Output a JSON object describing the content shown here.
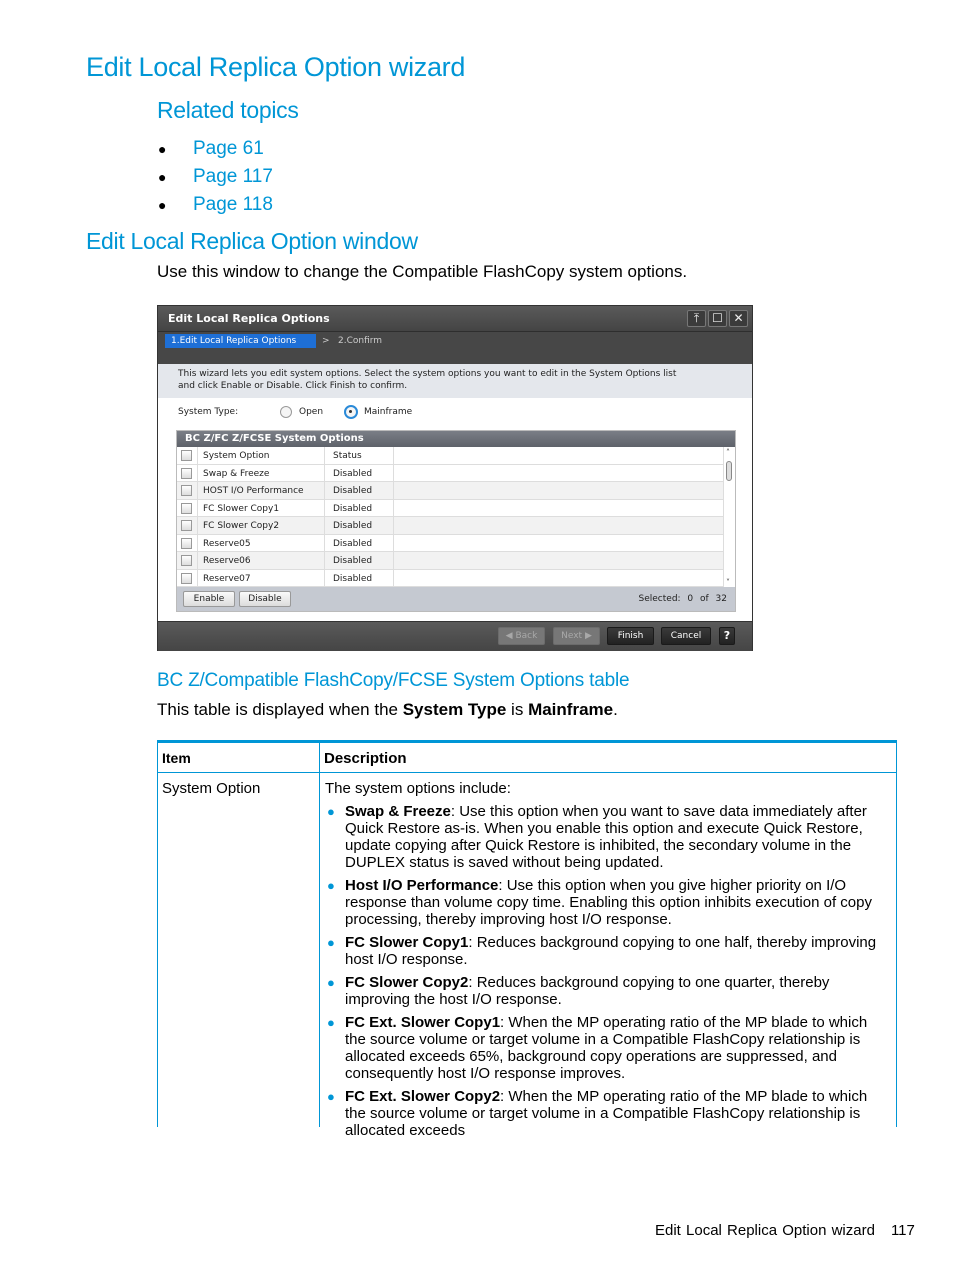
{
  "heading": "Edit Local Replica Option wizard",
  "related": {
    "title": "Related topics",
    "links": [
      "Page 61",
      "Page 117",
      "Page 118"
    ]
  },
  "window_section": {
    "title": "Edit Local Replica Option window",
    "intro": "Use this window to change the Compatible FlashCopy system options."
  },
  "dialog": {
    "title": "Edit Local Replica Options",
    "window_buttons": [
      "pin",
      "maximize",
      "close"
    ],
    "steps": {
      "current": "1.Edit Local Replica Options",
      "separator": ">",
      "next": "2.Confirm"
    },
    "description_line1": "This wizard lets you edit system options. Select the system options you want to edit in the System Options list",
    "description_line2": "and click Enable or Disable. Click Finish to confirm.",
    "system_type": {
      "label": "System Type:",
      "options": [
        "Open",
        "Mainframe"
      ],
      "selected": "Mainframe"
    },
    "panel_title": "BC Z/FC Z/FCSE System Options",
    "columns": [
      "System Option",
      "Status"
    ],
    "rows": [
      {
        "option": "Swap & Freeze",
        "status": "Disabled"
      },
      {
        "option": "HOST I/O Performance",
        "status": "Disabled"
      },
      {
        "option": "FC Slower Copy1",
        "status": "Disabled"
      },
      {
        "option": "FC Slower Copy2",
        "status": "Disabled"
      },
      {
        "option": "Reserve05",
        "status": "Disabled"
      },
      {
        "option": "Reserve06",
        "status": "Disabled"
      },
      {
        "option": "Reserve07",
        "status": "Disabled"
      }
    ],
    "enable_label": "Enable",
    "disable_label": "Disable",
    "selected_text": "Selected: 0 of 32",
    "footer": {
      "back": "Back",
      "next": "Next",
      "finish": "Finish",
      "cancel": "Cancel",
      "help": "?"
    }
  },
  "table_section": {
    "title": "BC Z/Compatible FlashCopy/FCSE System Options table",
    "intro_pre": "This table is displayed when the ",
    "intro_b1": "System Type",
    "intro_mid": " is ",
    "intro_b2": "Mainframe",
    "intro_post": ".",
    "headers": [
      "Item",
      "Description"
    ],
    "row_item": "System Option",
    "row_intro": "The system options include:",
    "bullets": [
      {
        "term": "Swap & Freeze",
        "text": ": Use this option when you want to save data immediately after Quick Restore as-is. When you enable this option and execute Quick Restore, update copying after Quick Restore is inhibited, the secondary volume in the DUPLEX status is saved without being updated."
      },
      {
        "term": "Host I/O Performance",
        "text": ": Use this option when you give higher priority on I/O response than volume copy time. Enabling this option inhibits execution of copy processing, thereby improving host I/O response."
      },
      {
        "term": "FC Slower Copy1",
        "text": ": Reduces background copying to one half, thereby improving host I/O response."
      },
      {
        "term": "FC Slower Copy2",
        "text": ": Reduces background copying to one quarter, thereby improving the host I/O response."
      },
      {
        "term": "FC Ext. Slower Copy1",
        "text": ": When the MP operating ratio of the MP blade to which the source volume or target volume in a Compatible FlashCopy relationship is allocated exceeds 65%, background copy operations are suppressed, and consequently host I/O response improves."
      },
      {
        "term": "FC Ext. Slower Copy2",
        "text": ": When the MP operating ratio of the MP blade to which the source volume or target volume in a Compatible FlashCopy relationship is allocated exceeds"
      }
    ]
  },
  "footer": {
    "title": "Edit Local Replica Option wizard",
    "page": "117"
  },
  "colors": {
    "accent": "#0096d6",
    "step_active": "#1e6fd6"
  }
}
